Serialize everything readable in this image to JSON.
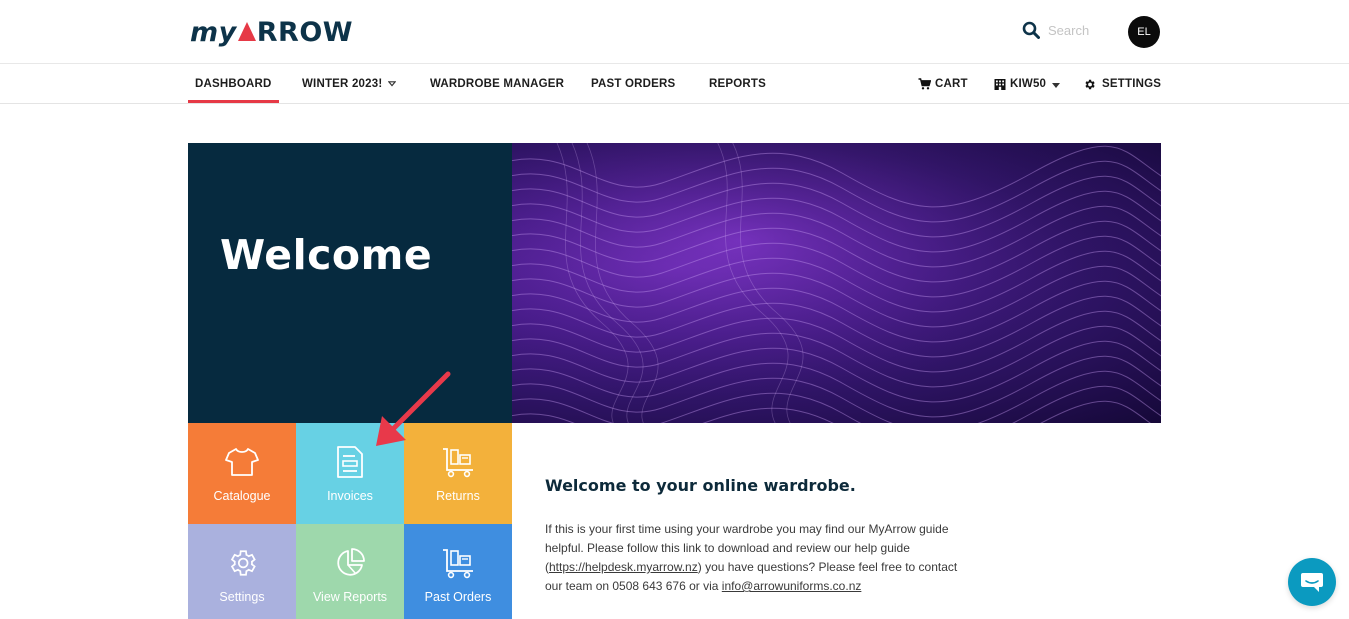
{
  "header": {
    "logo_my": "my",
    "logo_rest": "RROW",
    "search_placeholder": "Search",
    "avatar_initials": "EL"
  },
  "nav": {
    "dashboard": "DASHBOARD",
    "winter": "WINTER 2023!",
    "wardrobe_manager": "WARDROBE MANAGER",
    "past_orders": "PAST ORDERS",
    "reports": "REPORTS",
    "cart": "CART",
    "account": "KIW50",
    "settings": "SETTINGS"
  },
  "hero": {
    "title": "Welcome"
  },
  "tiles": [
    {
      "label": "Catalogue",
      "color": "#f57c38",
      "icon": "tshirt-icon"
    },
    {
      "label": "Invoices",
      "color": "#67d1e4",
      "icon": "invoice-icon"
    },
    {
      "label": "Returns",
      "color": "#f3b13b",
      "icon": "returns-trolley-icon"
    },
    {
      "label": "Settings",
      "color": "#aab1de",
      "icon": "gear-icon"
    },
    {
      "label": "View Reports",
      "color": "#9ed8ac",
      "icon": "pie-chart-icon"
    },
    {
      "label": "Past Orders",
      "color": "#3f8ee0",
      "icon": "trolley-icon"
    }
  ],
  "welcome": {
    "heading": "Welcome to your online wardrobe.",
    "text_1": "If this is your first time using your wardrobe you may find our MyArrow guide helpful. Please follow this link to download and review our help guide (",
    "link_helpdesk": "https://helpdesk.myarrow.nz",
    "text_2": ") you have questions? Please feel free to contact our team on 0508 643 676 or via ",
    "link_email": "info@arrowuniforms.co.nz"
  },
  "colors": {
    "brand_navy": "#062a3f",
    "accent_red": "#e63946",
    "chat_blue": "#0b9ac0"
  }
}
